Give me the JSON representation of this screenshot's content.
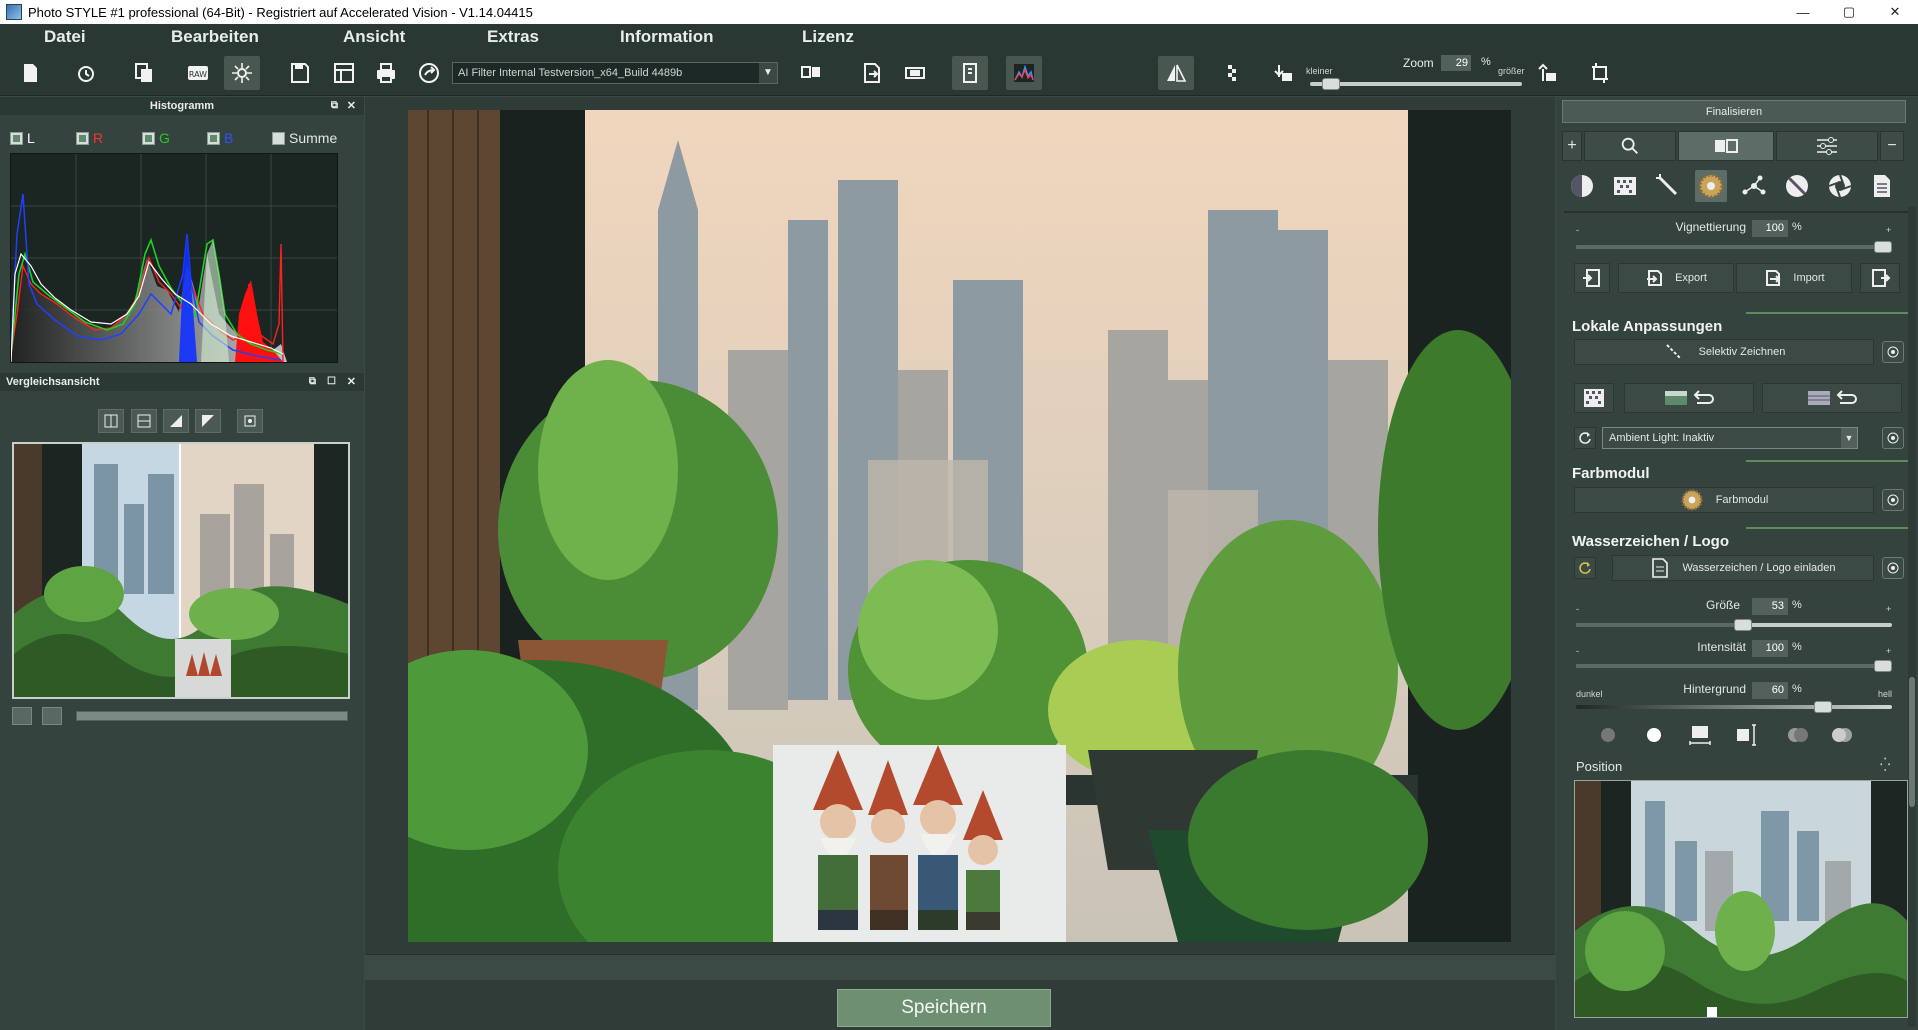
{
  "window": {
    "title": "Photo STYLE #1 professional (64-Bit) - Registriert auf Accelerated Vision - V1.14.04415",
    "controls": [
      "—",
      "▢",
      "✕"
    ]
  },
  "menu": [
    "Datei",
    "Bearbeiten",
    "Ansicht",
    "Extras",
    "Information",
    "Lizenz"
  ],
  "toolbar": {
    "filter_select": "AI Filter Internal Testversion_x64_Build 4489b",
    "zoom_label": "Zoom",
    "zoom_value": "29",
    "zoom_unit": "%",
    "smaller_label": "kleiner",
    "bigger_label": "größer",
    "zoom_level": 0.06
  },
  "histogram": {
    "title": "Histogramm",
    "channels": [
      {
        "label": "L",
        "color": "#ffffff",
        "checked": true
      },
      {
        "label": "R",
        "color": "#ff3030",
        "checked": true
      },
      {
        "label": "G",
        "color": "#30c030",
        "checked": true
      },
      {
        "label": "B",
        "color": "#3050ff",
        "checked": true
      }
    ],
    "sum_label": "Summe",
    "sum_checked": false
  },
  "compare": {
    "title": "Vergleichsansicht"
  },
  "save_button": "Speichern",
  "right": {
    "finalize_tab": "Finalisieren",
    "vignette_label": "Vignettierung",
    "vignette_value": "100",
    "vignette_level": 1.0,
    "export_label": "Export",
    "import_label": "Import",
    "local_title": "Lokale Anpassungen",
    "selective_label": "Selektiv Zeichnen",
    "ambient_select": "Ambient Light: Inaktiv",
    "color_title": "Farbmodul",
    "color_label": "Farbmodul",
    "watermark_title": "Wasserzeichen / Logo",
    "watermark_load": "Wasserzeichen / Logo einladen",
    "size_label": "Größe",
    "size_value": "53",
    "size_level": 0.53,
    "intensity_label": "Intensität",
    "intensity_value": "100",
    "intensity_level": 1.0,
    "background_label": "Hintergrund",
    "background_value": "60",
    "background_level": 0.8,
    "dark_label": "dunkel",
    "light_label": "hell",
    "unit": "%",
    "minus": "-",
    "plus": "+",
    "position_label": "Position"
  }
}
